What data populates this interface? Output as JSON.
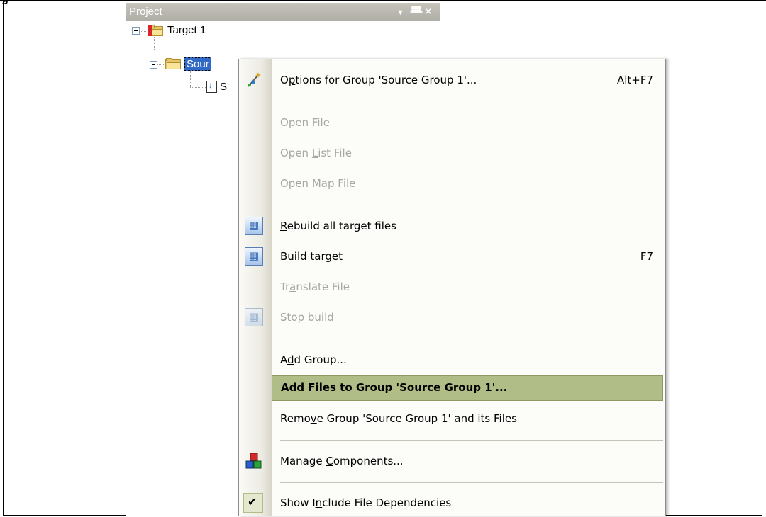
{
  "figure": {
    "label_fragment": "g"
  },
  "panel": {
    "title": "Project",
    "controls": {
      "dropdown": "▼",
      "pin": "ᵖ",
      "close": "✕"
    }
  },
  "tree": {
    "target": "Target 1",
    "group": "Sour",
    "file": "S"
  },
  "menu": {
    "items": [
      {
        "label_pre": "O",
        "label_ul": "p",
        "label_post": "tions for Group 'Source Group 1'...",
        "shortcut": "Alt+F7",
        "icon": "options-wand-icon",
        "enabled": true
      },
      {
        "label_pre": "",
        "label_ul": "O",
        "label_post": "pen File",
        "shortcut": "",
        "enabled": false
      },
      {
        "label_pre": "Open ",
        "label_ul": "L",
        "label_post": "ist File",
        "shortcut": "",
        "enabled": false
      },
      {
        "label_pre": "Open ",
        "label_ul": "M",
        "label_post": "ap File",
        "shortcut": "",
        "enabled": false
      },
      {
        "label_pre": "",
        "label_ul": "R",
        "label_post": "ebuild all target files",
        "shortcut": "",
        "icon": "rebuild-icon",
        "enabled": true
      },
      {
        "label_pre": "",
        "label_ul": "B",
        "label_post": "uild target",
        "shortcut": "F7",
        "icon": "build-icon",
        "enabled": true
      },
      {
        "label_pre": "Tr",
        "label_ul": "a",
        "label_post": "nslate File",
        "shortcut": "",
        "enabled": false
      },
      {
        "label_pre": "Stop b",
        "label_ul": "u",
        "label_post": "ild",
        "shortcut": "",
        "icon": "stop-build-icon",
        "enabled": false
      },
      {
        "label_pre": "A",
        "label_ul": "d",
        "label_post": "d Group...",
        "shortcut": "",
        "enabled": true
      },
      {
        "label_pre": "Add Files to Group 'Source Group 1'...",
        "label_ul": "",
        "label_post": "",
        "shortcut": "",
        "enabled": true,
        "highlighted": true
      },
      {
        "label_pre": "Remo",
        "label_ul": "v",
        "label_post": "e Group 'Source Group 1' and its Files",
        "shortcut": "",
        "enabled": true
      },
      {
        "label_pre": "Manage ",
        "label_ul": "C",
        "label_post": "omponents...",
        "shortcut": "",
        "icon": "manage-components-icon",
        "enabled": true
      },
      {
        "label_pre": "Show I",
        "label_ul": "n",
        "label_post": "clude File Dependencies",
        "shortcut": "",
        "icon": "checkmark-icon",
        "enabled": true,
        "checked": true
      }
    ]
  },
  "colors": {
    "highlight": "#b1bd87",
    "disabled_text": "#a7a6a0",
    "titlebar": "#bdbbb2"
  }
}
